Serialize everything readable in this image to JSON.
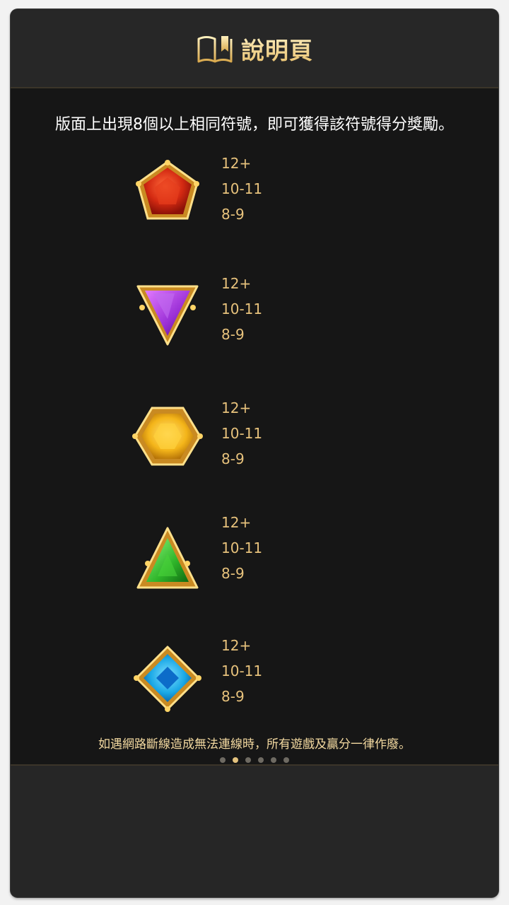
{
  "header": {
    "title": "說明頁",
    "icon": "book-icon"
  },
  "intro": "版面上出現8個以上相同符號，即可獲得該符號得分獎勵。",
  "symbols": [
    {
      "name": "red-gem",
      "color": "#d9321a",
      "pays": [
        "12+",
        "10-11",
        "8-9"
      ]
    },
    {
      "name": "purple-gem",
      "color": "#9a2fd6",
      "pays": [
        "12+",
        "10-11",
        "8-9"
      ]
    },
    {
      "name": "yellow-gem",
      "color": "#f4c21a",
      "pays": [
        "12+",
        "10-11",
        "8-9"
      ]
    },
    {
      "name": "green-gem",
      "color": "#2fb52a",
      "pays": [
        "12+",
        "10-11",
        "8-9"
      ]
    },
    {
      "name": "blue-gem",
      "color": "#1aa8e6",
      "pays": [
        "12+",
        "10-11",
        "8-9"
      ]
    }
  ],
  "notice": "如遇網路斷線造成無法連線時，所有遊戲及贏分一律作廢。",
  "pager": {
    "total": 6,
    "active": 2
  }
}
